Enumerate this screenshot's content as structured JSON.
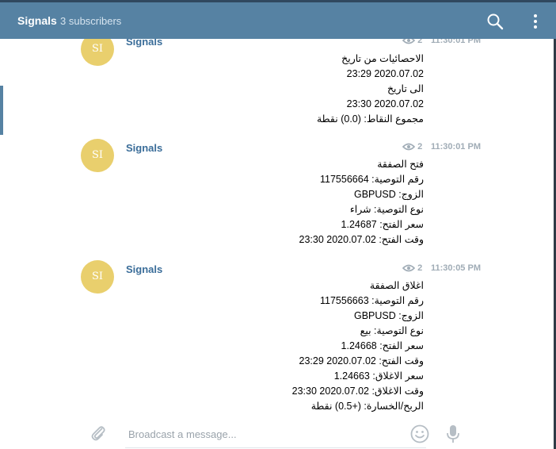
{
  "header": {
    "title": "Signals",
    "subscribers": "3 subscribers"
  },
  "messages": [
    {
      "avatar_initials": "SI",
      "author": "Signals",
      "views": "2",
      "time": "11:30:01 PM",
      "lines": [
        "الاحصائيات من تاريخ",
        "2020.07.02 23:29",
        "الى تاريخ",
        "2020.07.02 23:30",
        "مجموع النقاط: (0.0) نقطة"
      ]
    },
    {
      "avatar_initials": "SI",
      "author": "Signals",
      "views": "2",
      "time": "11:30:01 PM",
      "lines": [
        "فتح الصفقة",
        "رقم التوصية: 117556664",
        "الزوج: GBPUSD",
        "نوع التوصية: شراء",
        "سعر الفتح: 1.24687",
        "وقت الفتح: 2020.07.02 23:30"
      ]
    },
    {
      "avatar_initials": "SI",
      "author": "Signals",
      "views": "2",
      "time": "11:30:05 PM",
      "lines": [
        "اغلاق الصفقة",
        "رقم التوصية: 117556663",
        "الزوج: GBPUSD",
        "نوع التوصية: بيع",
        "سعر الفتح: 1.24668",
        "وقت الفتح: 2020.07.02 23:29",
        "سعر الاغلاق: 1.24663",
        "وقت الاغلاق: 2020.07.02 23:30",
        "الربح/الخسارة: (+0.5) نقطة"
      ]
    }
  ],
  "composer": {
    "placeholder": "Broadcast a message..."
  },
  "icons": {
    "search": "search-icon",
    "more": "more-vertical-icon",
    "views": "eye-icon",
    "attach": "paperclip-icon",
    "emoji": "emoji-icon",
    "mic": "microphone-icon"
  },
  "colors": {
    "header_bg": "#5682a3",
    "avatar_bg": "#e9cf6d",
    "author": "#3a6d99",
    "meta": "#a0acb6"
  }
}
